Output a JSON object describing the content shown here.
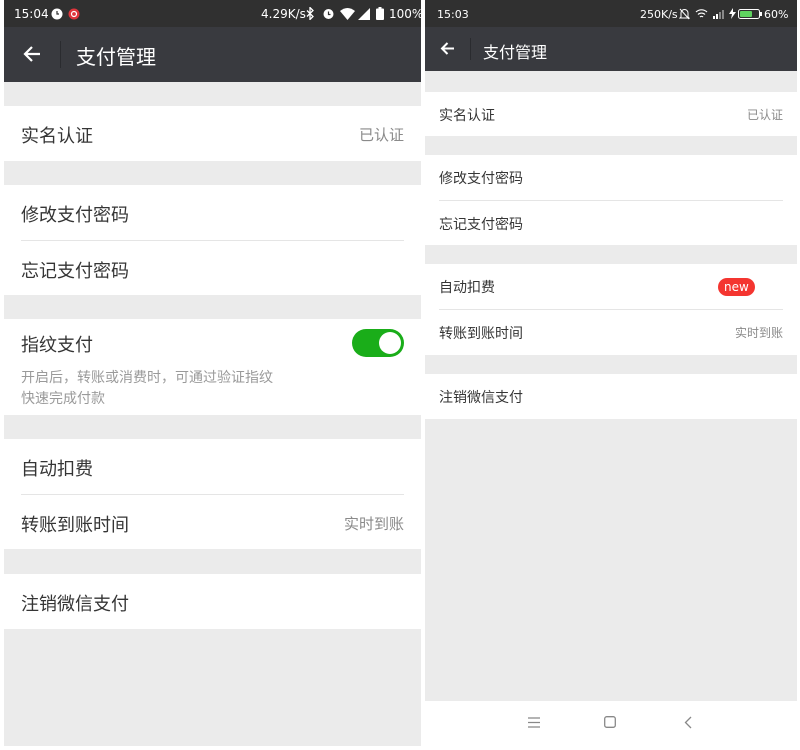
{
  "left": {
    "status": {
      "time": "15:04",
      "speed": "4.29K/s",
      "battery": "100%",
      "icons": [
        "clock-icon",
        "netease-music-icon",
        "bluetooth-icon",
        "alarm-icon",
        "wifi-icon",
        "signal-icon",
        "battery-icon"
      ]
    },
    "toolbar": {
      "title": "支付管理",
      "back_icon": "back-arrow-icon"
    },
    "rows": {
      "real_name": {
        "label": "实名认证",
        "value": "已认证"
      },
      "change_password": {
        "label": "修改支付密码"
      },
      "forgot_password": {
        "label": "忘记支付密码"
      },
      "fingerprint": {
        "label": "指纹支付",
        "enabled": true,
        "desc_line1": "开启后，转账或消费时，可通过验证指纹",
        "desc_line2": "快速完成付款"
      },
      "auto_deduct": {
        "label": "自动扣费"
      },
      "transfer_time": {
        "label": "转账到账时间",
        "value": "实时到账"
      },
      "cancel": {
        "label": "注销微信支付"
      }
    }
  },
  "right": {
    "status": {
      "time": "15:03",
      "speed": "250K/s",
      "battery": "60%",
      "icons": [
        "mute-icon",
        "wifi-icon",
        "signal-icon",
        "charging-icon",
        "battery-icon"
      ]
    },
    "toolbar": {
      "title": "支付管理",
      "back_icon": "back-arrow-icon"
    },
    "rows": {
      "real_name": {
        "label": "实名认证",
        "value": "已认证"
      },
      "change_password": {
        "label": "修改支付密码"
      },
      "forgot_password": {
        "label": "忘记支付密码"
      },
      "auto_deduct": {
        "label": "自动扣费",
        "badge": "new"
      },
      "transfer_time": {
        "label": "转账到账时间",
        "value": "实时到账"
      },
      "cancel": {
        "label": "注销微信支付"
      }
    },
    "navbar": {
      "icons": [
        "menu-icon",
        "home-icon",
        "back-icon"
      ]
    }
  },
  "colors": {
    "toggle_on": "#1aad19",
    "badge": "#f43530",
    "toolbar": "#393a3f",
    "background": "#ebebeb"
  }
}
